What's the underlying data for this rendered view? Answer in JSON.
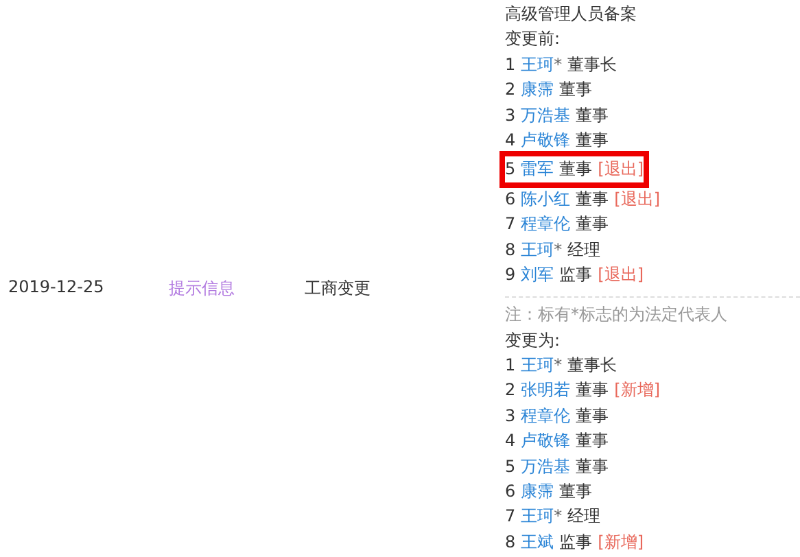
{
  "record": {
    "date": "2019-12-25",
    "category": "提示信息",
    "type": "工商变更"
  },
  "detail": {
    "title": "高级管理人员备案",
    "before": {
      "label": "变更前:",
      "items": [
        {
          "no": "1",
          "name": "王珂",
          "mark": "*",
          "role": "董事长",
          "highlighted": false
        },
        {
          "no": "2",
          "name": "康霈",
          "role": "董事",
          "highlighted": false
        },
        {
          "no": "3",
          "name": "万浩基",
          "role": "董事",
          "highlighted": false
        },
        {
          "no": "4",
          "name": "卢敬锋",
          "role": "董事",
          "highlighted": false
        },
        {
          "no": "5",
          "name": "雷军",
          "role": "董事",
          "tag": "[退出]",
          "highlighted": true
        },
        {
          "no": "6",
          "name": "陈小红",
          "role": "董事",
          "tag": "[退出]",
          "highlighted": false
        },
        {
          "no": "7",
          "name": "程章伦",
          "role": "董事",
          "highlighted": false
        },
        {
          "no": "8",
          "name": "王珂",
          "mark": "*",
          "role": "经理",
          "highlighted": false
        },
        {
          "no": "9",
          "name": "刘军",
          "role": "监事",
          "tag": "[退出]",
          "highlighted": false
        }
      ]
    },
    "note": "注：标有*标志的为法定代表人",
    "after": {
      "label": "变更为:",
      "items": [
        {
          "no": "1",
          "name": "王珂",
          "mark": "*",
          "role": "董事长",
          "highlighted": false
        },
        {
          "no": "2",
          "name": "张明若",
          "role": "董事",
          "tag": "[新增]",
          "highlighted": false
        },
        {
          "no": "3",
          "name": "程章伦",
          "role": "董事",
          "highlighted": false
        },
        {
          "no": "4",
          "name": "卢敬锋",
          "role": "董事",
          "highlighted": false
        },
        {
          "no": "5",
          "name": "万浩基",
          "role": "董事",
          "highlighted": false
        },
        {
          "no": "6",
          "name": "康霈",
          "role": "董事",
          "highlighted": false
        },
        {
          "no": "7",
          "name": "王珂",
          "mark": "*",
          "role": "经理",
          "highlighted": false
        },
        {
          "no": "8",
          "name": "王斌",
          "role": "监事",
          "tag": "[新增]",
          "highlighted": false
        }
      ]
    }
  }
}
